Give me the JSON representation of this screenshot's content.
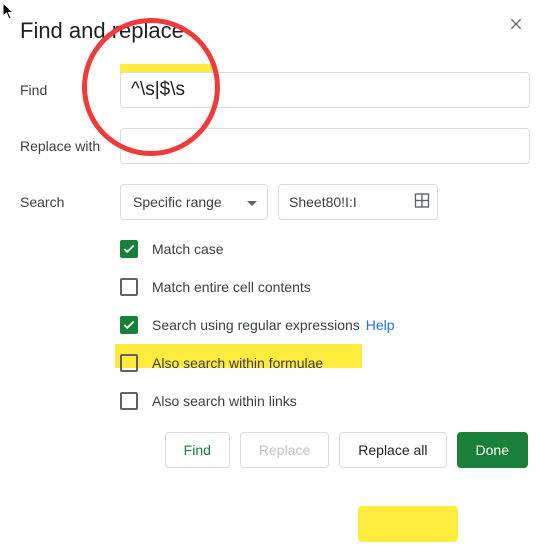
{
  "dialog": {
    "title": "Find and replace"
  },
  "labels": {
    "find": "Find",
    "replace_with": "Replace with",
    "search": "Search"
  },
  "fields": {
    "find_value": "^\\s|$\\s",
    "replace_value": "",
    "scope_selected": "Specific range",
    "range_value": "Sheet80!I:I"
  },
  "options": {
    "match_case": {
      "label": "Match case",
      "checked": true
    },
    "match_entire": {
      "label": "Match entire cell contents",
      "checked": false
    },
    "regex": {
      "label": "Search using regular expressions",
      "checked": true,
      "help": "Help"
    },
    "formulae": {
      "label": "Also search within formulae",
      "checked": false
    },
    "links": {
      "label": "Also search within links",
      "checked": false
    }
  },
  "buttons": {
    "find": "Find",
    "replace": "Replace",
    "replace_all": "Replace all",
    "done": "Done"
  }
}
